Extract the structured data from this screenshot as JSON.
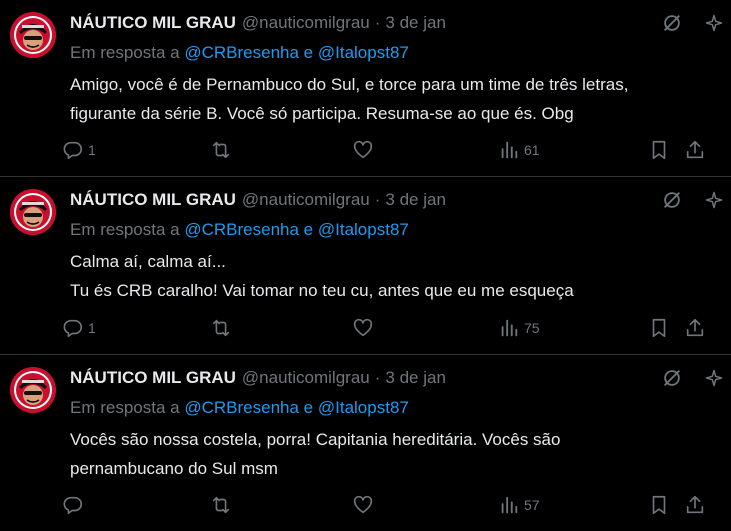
{
  "tweets": [
    {
      "name": "NÁUTICO MIL GRAU",
      "handle": "@nauticomilgrau",
      "separator": "·",
      "date": "3 de jan",
      "reply_prefix": "Em resposta a",
      "reply_user1": "@CRBresenha",
      "reply_joiner": "e",
      "reply_user2": "@Italopst87",
      "lines": [
        "Amigo, você é de Pernambuco do Sul, e torce para um time de três letras,",
        "figurante da série B. Você só participa. Resuma-se ao que és. Obg"
      ],
      "replies": "1",
      "retweets": "",
      "likes": "",
      "views": "61"
    },
    {
      "name": "NÁUTICO MIL GRAU",
      "handle": "@nauticomilgrau",
      "separator": "·",
      "date": "3 de jan",
      "reply_prefix": "Em resposta a",
      "reply_user1": "@CRBresenha",
      "reply_joiner": "e",
      "reply_user2": "@Italopst87",
      "lines": [
        "Calma aí, calma aí...",
        "Tu és CRB caralho! Vai tomar no teu cu, antes que eu me esqueça"
      ],
      "replies": "1",
      "retweets": "",
      "likes": "",
      "views": "75"
    },
    {
      "name": "NÁUTICO MIL GRAU",
      "handle": "@nauticomilgrau",
      "separator": "·",
      "date": "3 de jan",
      "reply_prefix": "Em resposta a",
      "reply_user1": "@CRBresenha",
      "reply_joiner": "e",
      "reply_user2": "@Italopst87",
      "lines": [
        "Vocês são nossa costela, porra! Capitania hereditária. Vocês são",
        "pernambucano do Sul msm"
      ],
      "replies": "",
      "retweets": "",
      "likes": "",
      "views": "57"
    }
  ],
  "icons": {
    "reply": "reply-icon",
    "retweet": "retweet-icon",
    "like": "heart-icon",
    "views": "views-icon",
    "bookmark": "bookmark-icon",
    "share": "share-icon",
    "grok": "grok-icon",
    "more": "more-icon",
    "avatar": "avatar-logo"
  },
  "colors": {
    "background": "#000000",
    "text": "#e7e9ea",
    "muted": "#71767b",
    "link": "#1d9bf0",
    "divider": "#2f3336",
    "avatar_red": "#c8102e"
  }
}
